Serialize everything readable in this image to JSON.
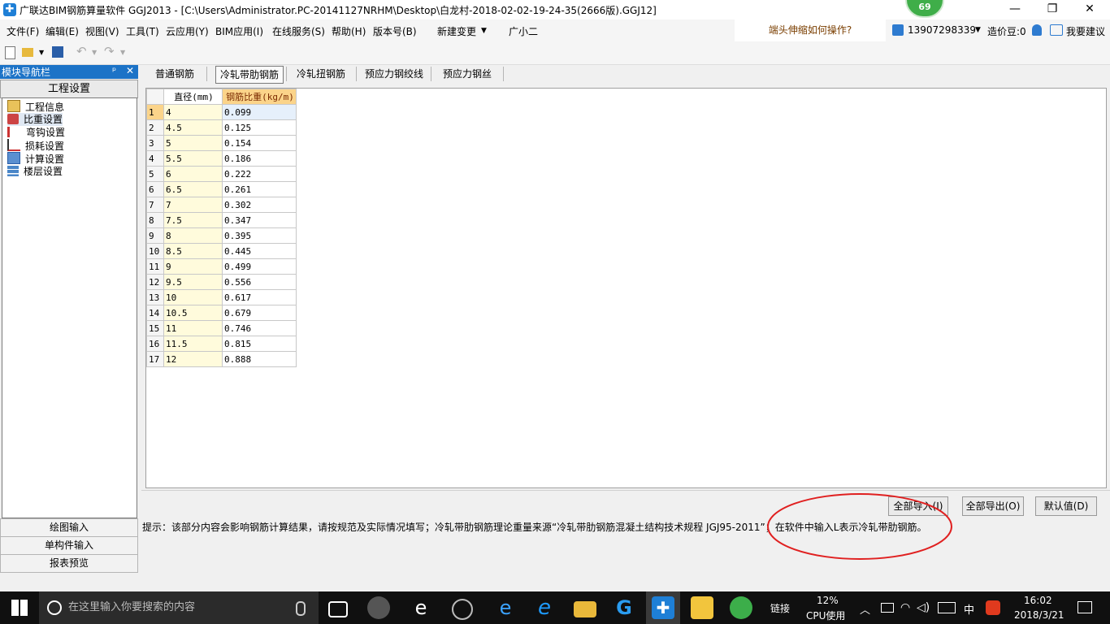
{
  "titlebar": {
    "title": "广联达BIM钢筋算量软件 GGJ2013 - [C:\\Users\\Administrator.PC-20141127NRHM\\Desktop\\白龙村-2018-02-02-19-24-35(2666版).GGJ12]",
    "badge": "69",
    "minimize": "—",
    "restore": "❐",
    "close": "✕"
  },
  "menu": {
    "items": [
      "文件(F)",
      "编辑(E)",
      "视图(V)",
      "工具(T)",
      "云应用(Y)",
      "BIM应用(I)",
      "在线服务(S)",
      "帮助(H)",
      "版本号(B)",
      "新建变更",
      "广小二"
    ],
    "question": "端头伸缩如何操作?",
    "account": "13907298339",
    "coins": "造价豆:0",
    "suggest": "我要建议"
  },
  "nav": {
    "header": "模块导航栏",
    "pin": "ᵖ",
    "close": "✕",
    "section": "工程设置",
    "tree": [
      "工程信息",
      "比重设置",
      "弯钩设置",
      "损耗设置",
      "计算设置",
      "楼层设置"
    ],
    "buttons": [
      "绘图输入",
      "单构件输入",
      "报表预览"
    ]
  },
  "tabs": [
    "普通钢筋",
    "冷轧带肋钢筋",
    "冷轧扭钢筋",
    "预应力钢绞线",
    "预应力钢丝"
  ],
  "grid": {
    "headers": [
      "直径(mm)",
      "钢筋比重(kg/m)"
    ],
    "rows": [
      [
        "1",
        "4",
        "0.099"
      ],
      [
        "2",
        "4.5",
        "0.125"
      ],
      [
        "3",
        "5",
        "0.154"
      ],
      [
        "4",
        "5.5",
        "0.186"
      ],
      [
        "5",
        "6",
        "0.222"
      ],
      [
        "6",
        "6.5",
        "0.261"
      ],
      [
        "7",
        "7",
        "0.302"
      ],
      [
        "8",
        "7.5",
        "0.347"
      ],
      [
        "9",
        "8",
        "0.395"
      ],
      [
        "10",
        "8.5",
        "0.445"
      ],
      [
        "11",
        "9",
        "0.499"
      ],
      [
        "12",
        "9.5",
        "0.556"
      ],
      [
        "13",
        "10",
        "0.617"
      ],
      [
        "14",
        "10.5",
        "0.679"
      ],
      [
        "15",
        "11",
        "0.746"
      ],
      [
        "16",
        "11.5",
        "0.815"
      ],
      [
        "17",
        "12",
        "0.888"
      ]
    ]
  },
  "buttons": {
    "import_all": "全部导入(I)",
    "export_all": "全部导出(O)",
    "default": "默认值(D)"
  },
  "hint": "提示：该部分内容会影响钢筋计算结果，请按规范及实际情况填写；冷轧带肋钢筋理论重量来源“冷轧带肋钢筋混凝土结构技术规程 JGJ95-2011”；在软件中输入L表示冷轧带肋钢筋。",
  "taskbar": {
    "search_placeholder": "在这里输入你要搜索的内容",
    "link": "链接",
    "cpu_pct": "12%",
    "cpu_label": "CPU使用",
    "ime": "中",
    "time": "16:02",
    "date": "2018/3/21"
  },
  "colors": {
    "accent": "#1c73c7",
    "highlight_header": "#fbd48a",
    "annotation_circle": "#e02020"
  }
}
